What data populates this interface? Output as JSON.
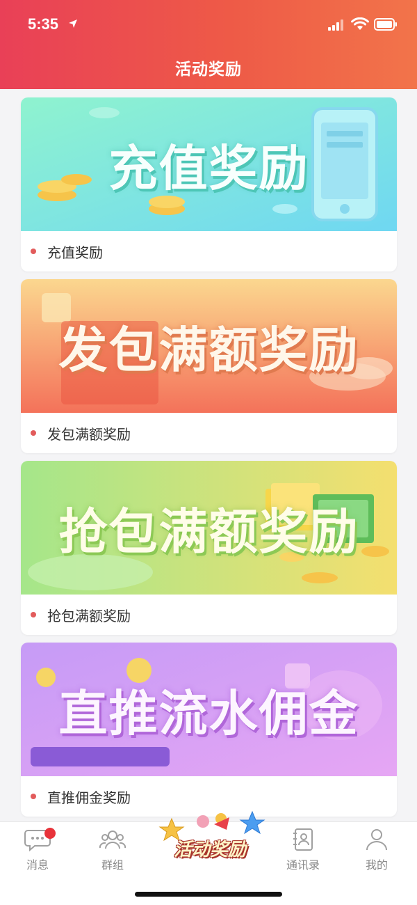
{
  "status_bar": {
    "time": "5:35"
  },
  "header": {
    "title": "活动奖励"
  },
  "cards": [
    {
      "banner_text": "充值奖励",
      "caption": "充值奖励"
    },
    {
      "banner_text": "发包满额奖励",
      "caption": "发包满额奖励"
    },
    {
      "banner_text": "抢包满额奖励",
      "caption": "抢包满额奖励"
    },
    {
      "banner_text": "直推流水佣金",
      "caption": "直推佣金奖励"
    }
  ],
  "tabbar": {
    "items": [
      {
        "label": "消息",
        "icon": "chat-icon"
      },
      {
        "label": "群组",
        "icon": "group-icon"
      },
      {
        "label": "活动奖励",
        "icon": "activity-icon"
      },
      {
        "label": "通讯录",
        "icon": "contacts-icon"
      },
      {
        "label": "我的",
        "icon": "profile-icon"
      }
    ]
  },
  "colors": {
    "header_start": "#e94057",
    "header_end": "#f2744a",
    "badge": "#e8333a",
    "dot": "#e25b5b"
  }
}
